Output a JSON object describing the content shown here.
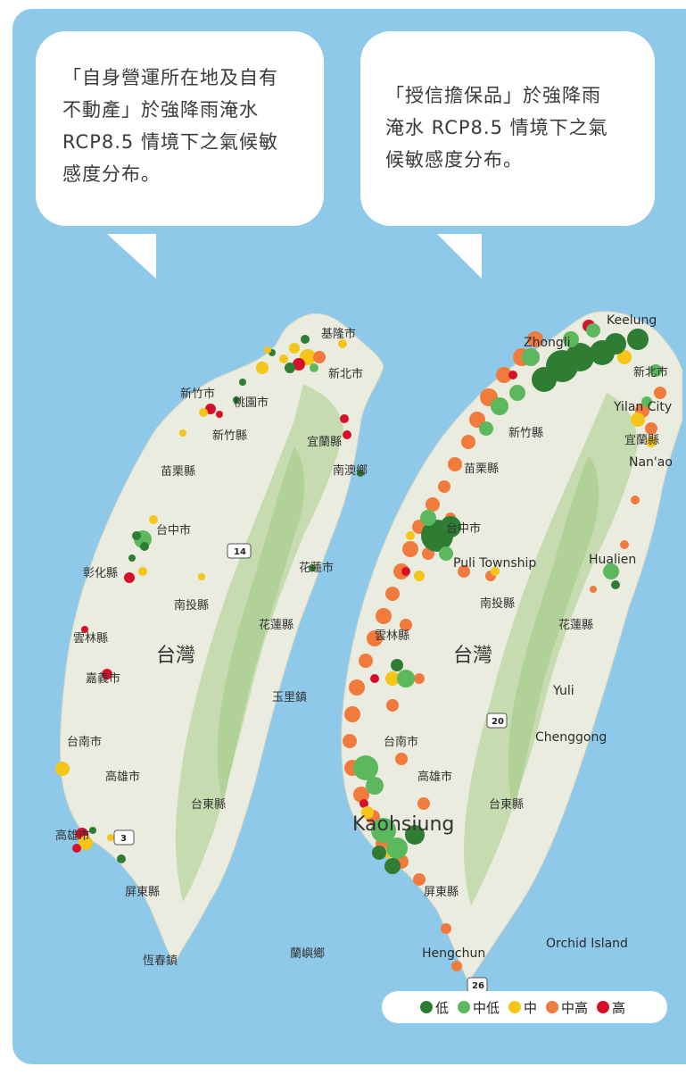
{
  "bubbles": {
    "left": "「自身營運所在地及自有\n不動產」於強降雨淹水\nRCP8.5 情境下之氣候敏\n感度分布。",
    "right": "「授信擔保品」於強降雨\n淹水 RCP8.5 情境下之氣\n候敏感度分布。"
  },
  "colors": {
    "background": "#8ec9ea",
    "land": "#e9ecdf",
    "mountain": "#bfd9a8",
    "low": "#2e7d32",
    "mid_low": "#5cb85c",
    "mid": "#f5c518",
    "mid_high": "#f07b3c",
    "high": "#d7102a"
  },
  "legend": [
    {
      "label": "低",
      "color": "#2e7d32"
    },
    {
      "label": "中低",
      "color": "#5cb85c"
    },
    {
      "label": "中",
      "color": "#f5c518"
    },
    {
      "label": "中高",
      "color": "#f07b3c"
    },
    {
      "label": "高",
      "color": "#d7102a"
    }
  ],
  "left_map": {
    "labels": {
      "keelung": "基隆市",
      "new_taipei": "新北市",
      "taoyuan": "桃園市",
      "hsinchu_city": "新竹市",
      "hsinchu_county": "新竹縣",
      "yilan": "宜蘭縣",
      "nanao": "南澳鄉",
      "miaoli": "苗栗縣",
      "taichung": "台中市",
      "changhua": "彰化縣",
      "nantou": "南投縣",
      "yunlin": "雲林縣",
      "chiayi": "嘉義市",
      "hualien_city": "花蓮市",
      "hualien_county": "花蓮縣",
      "taiwan": "台灣",
      "yuli": "玉里鎮",
      "tainan": "台南市",
      "kaohsiung": "高雄市",
      "taitung": "台東縣",
      "kaohsiung_city": "高雄市",
      "pingtung": "屏東縣",
      "hengchun": "恆春鎮",
      "lanyu": "蘭嶼鄉",
      "shield_14": "14",
      "shield_3": "3"
    }
  },
  "right_map": {
    "labels": {
      "keelung": "Keelung",
      "zhongli": "Zhongli",
      "new_taipei": "新北市",
      "yilan_city": "Yilan City",
      "yilan_county": "宜蘭縣",
      "nanao": "Nan'ao",
      "hsinchu": "新竹縣",
      "miaoli": "苗栗縣",
      "taichung": "台中市",
      "puli": "Puli Township",
      "hualien": "Hualien",
      "nantou": "南投縣",
      "hualien_county": "花蓮縣",
      "yunlin": "雲林縣",
      "taiwan": "台灣",
      "yuli": "Yuli",
      "shield_20": "20",
      "chenggong": "Chenggong",
      "tainan": "台南市",
      "kaohsiung_city": "高雄市",
      "taitung": "台東縣",
      "kaohsiung": "Kaohsiung",
      "pingtung": "屏東縣",
      "orchid": "Orchid Island",
      "hengchun": "Hengchun",
      "shield_26": "26"
    }
  }
}
